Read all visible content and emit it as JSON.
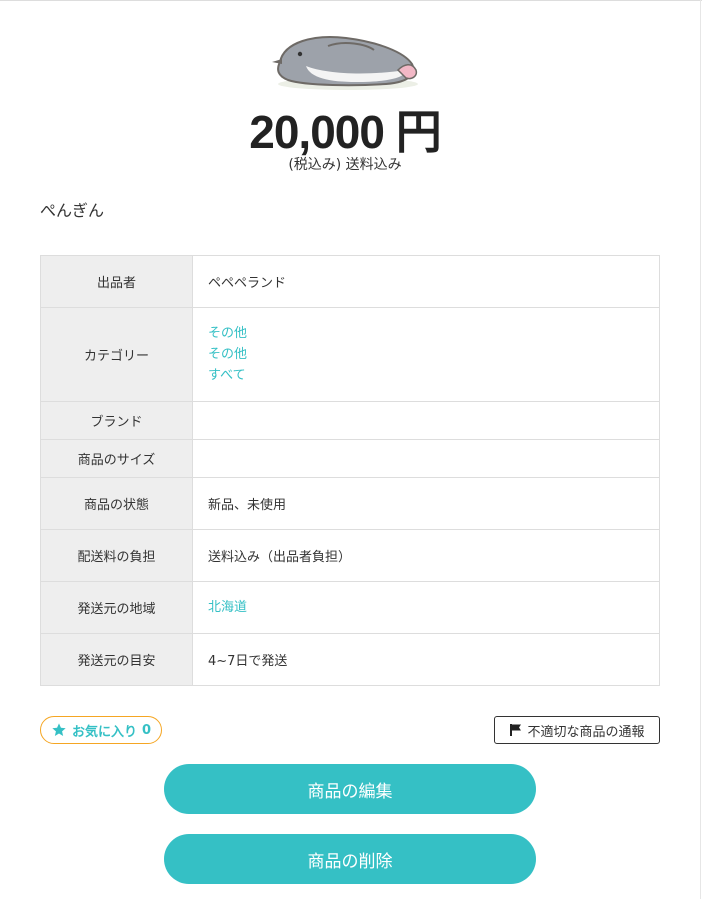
{
  "product": {
    "image_icon": "penguin-illustration",
    "price": "20,000 円",
    "price_note": "(税込み) 送料込み",
    "name": "ぺんぎん"
  },
  "details": {
    "seller_label": "出品者",
    "seller_value": "ペペペランド",
    "category_label": "カテゴリー",
    "categories": [
      "その他",
      "その他",
      "すべて"
    ],
    "brand_label": "ブランド",
    "brand_value": "",
    "size_label": "商品のサイズ",
    "size_value": "",
    "condition_label": "商品の状態",
    "condition_value": "新品、未使用",
    "shipping_fee_label": "配送料の負担",
    "shipping_fee_value": "送料込み（出品者負担）",
    "ship_from_label": "発送元の地域",
    "ship_from_value": "北海道",
    "ship_days_label": "発送元の目安",
    "ship_days_value": "4~7日で発送"
  },
  "actions": {
    "favorite_label": "お気に入り",
    "favorite_count": "0",
    "favorite_icon": "star-icon",
    "report_label": "不適切な商品の通報",
    "report_icon": "flag-icon",
    "edit_label": "商品の編集",
    "delete_label": "商品の削除"
  },
  "colors": {
    "accent": "#35c0c5",
    "favorite_border": "#f5a623",
    "header_cell": "#eeeeee"
  }
}
